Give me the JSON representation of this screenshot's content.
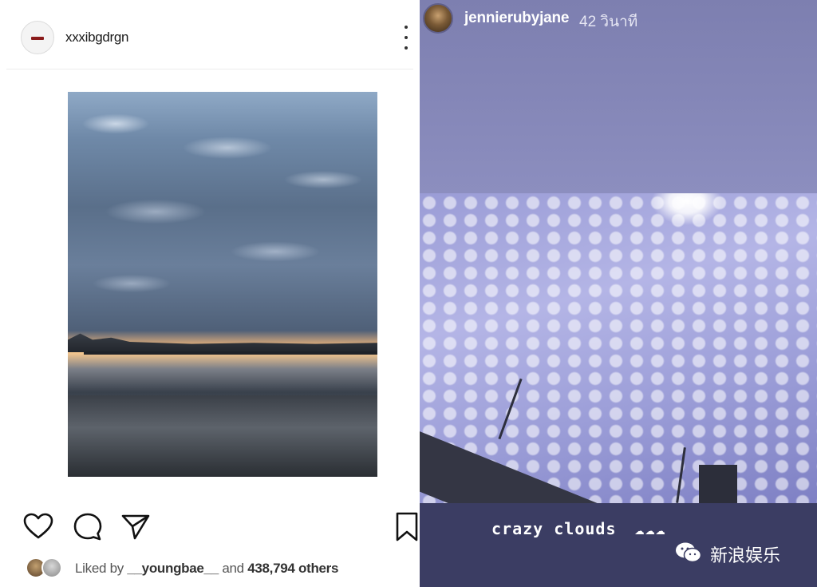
{
  "post": {
    "username": "xxxibgdrgn",
    "likes": {
      "prefix": "Liked by",
      "user": "__youngbae__",
      "connector": "and",
      "count": "438,794 others"
    },
    "actions": [
      "heart-icon",
      "comment-icon",
      "share-icon",
      "bookmark-icon"
    ]
  },
  "story": {
    "username": "jennierubyjane",
    "time": "42 วินาที",
    "caption": "crazy clouds",
    "caption_emoji": "☁☁☁"
  },
  "watermark": {
    "text": "新浪娱乐"
  },
  "colors": {
    "story_background": "#8587b8",
    "story_bottom": "#3b3d63",
    "avatar_mark": "#8a1b1b"
  }
}
